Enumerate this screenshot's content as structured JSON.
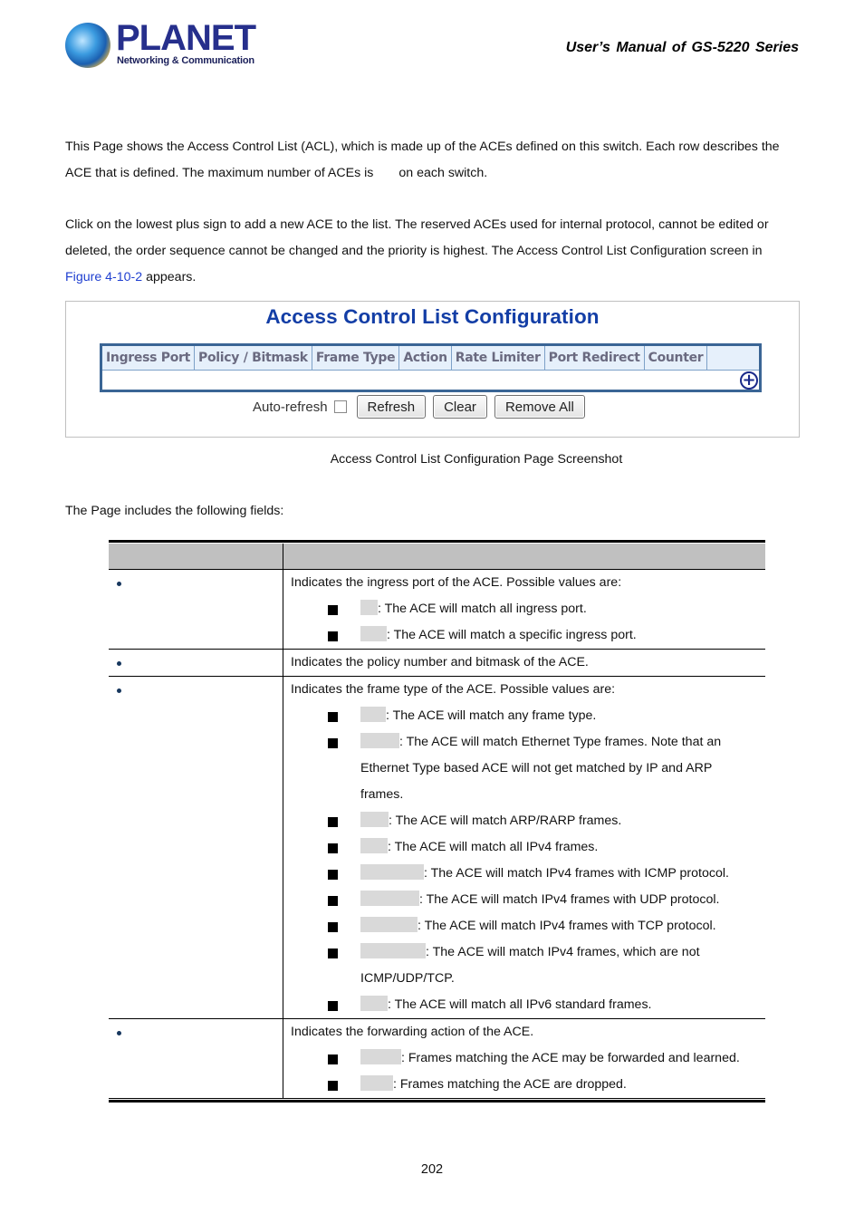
{
  "header": {
    "logo_word": "PLANET",
    "logo_tagline": "Networking & Communication",
    "manual_title": "User’s  Manual  of  GS-5220  Series"
  },
  "intro": {
    "p1_line1": "This Page shows the Access Control List (ACL), which is made up of the ACEs defined on this switch. Each row describes the",
    "p1_line2_a": "ACE that is defined. The maximum number of ACEs is",
    "p1_line2_b": "on each switch.",
    "p2_line1": "Click on the lowest plus sign to add a new ACE to the list. The reserved ACEs used for internal protocol, cannot be edited or",
    "p2_line2": "deleted, the order sequence cannot be changed and the priority is highest. The Access Control List Configuration screen in",
    "p2_link": "Figure 4-10-2",
    "p2_line3_rest": " appears."
  },
  "screenshot": {
    "title": "Access Control List Configuration",
    "columns": [
      "Ingress Port",
      "Policy / Bitmask",
      "Frame Type",
      "Action",
      "Rate Limiter",
      "Port Redirect",
      "Counter"
    ],
    "add_icon": "plus-circle-icon",
    "auto_refresh_label": "Auto-refresh",
    "auto_refresh_checked": false,
    "buttons": {
      "refresh": "Refresh",
      "clear": "Clear",
      "remove_all": "Remove All"
    },
    "colors": {
      "title": "#133ea6",
      "table_border": "#3a6595",
      "header_bg": "#e6f0fb"
    }
  },
  "caption": "Access Control List Configuration Page Screenshot",
  "fields_intro": "The Page includes the following fields:",
  "fields": {
    "rows": [
      {
        "lines": [
          {
            "type": "text",
            "text": "Indicates the ingress port of the ACE. Possible values are:"
          },
          {
            "type": "opt",
            "text": ": The ACE will match all ingress port."
          },
          {
            "type": "opt",
            "text": ": The ACE will match a specific ingress port."
          }
        ]
      },
      {
        "lines": [
          {
            "type": "text",
            "text": "Indicates the policy number and bitmask of the ACE."
          }
        ]
      },
      {
        "lines": [
          {
            "type": "text",
            "text": "Indicates the frame type of the ACE. Possible values are:"
          },
          {
            "type": "opt",
            "text": ": The ACE will match any frame type."
          },
          {
            "type": "opt",
            "text": ": The ACE will match Ethernet Type frames. Note that an"
          },
          {
            "type": "cont",
            "text": "Ethernet Type based ACE will not get matched by IP and ARP"
          },
          {
            "type": "cont",
            "text": "frames."
          },
          {
            "type": "opt",
            "text": ": The ACE will match ARP/RARP frames."
          },
          {
            "type": "opt",
            "text": ": The ACE will match all IPv4 frames."
          },
          {
            "type": "opt",
            "text": ": The ACE will match IPv4 frames with ICMP protocol."
          },
          {
            "type": "opt",
            "text": ": The ACE will match IPv4 frames with UDP protocol."
          },
          {
            "type": "opt",
            "text": ": The ACE will match IPv4 frames with TCP protocol."
          },
          {
            "type": "opt",
            "text": ": The ACE will match IPv4 frames, which are not"
          },
          {
            "type": "cont",
            "text": "ICMP/UDP/TCP."
          },
          {
            "type": "opt",
            "text": ": The ACE will match all IPv6 standard frames."
          }
        ]
      },
      {
        "lines": [
          {
            "type": "text",
            "text": "Indicates the forwarding action of the ACE."
          },
          {
            "type": "opt",
            "text": ": Frames matching the ACE may be forwarded and learned."
          },
          {
            "type": "opt",
            "text": ": Frames matching the ACE are dropped."
          }
        ]
      }
    ]
  },
  "footer": {
    "page_number": "202"
  }
}
